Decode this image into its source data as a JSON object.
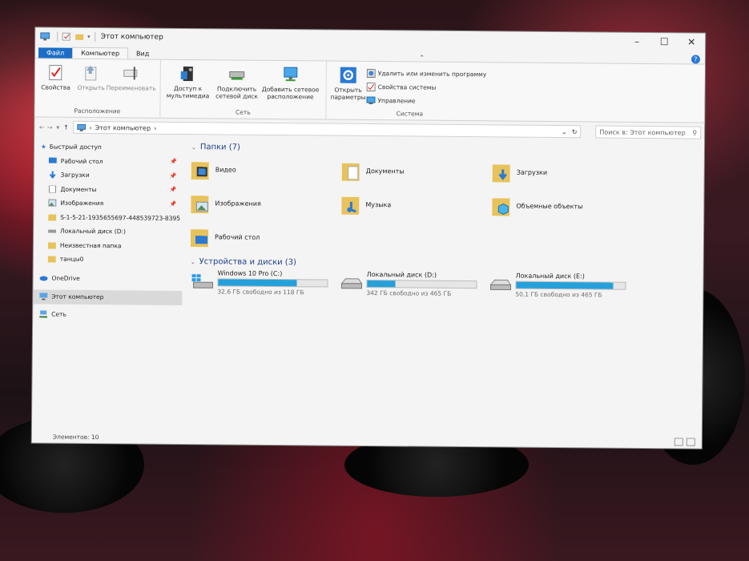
{
  "window": {
    "title": "Этот компьютер",
    "controls": [
      "–",
      "☐",
      "✕"
    ]
  },
  "ribbon_tabs": [
    "Файл",
    "Компьютер",
    "Вид"
  ],
  "ribbon": {
    "location_group": {
      "label": "Расположение",
      "buttons": [
        "Свойства",
        "Открыть",
        "Переименовать"
      ]
    },
    "network_group": {
      "label": "Сеть",
      "buttons": [
        "Доступ к мультимедиа",
        "Подключить сетевой диск",
        "Добавить сетевое расположение"
      ]
    },
    "system_group": {
      "label": "Система",
      "open_settings": "Открыть параметры",
      "items": [
        "Удалить или изменить программу",
        "Свойства системы",
        "Управление"
      ]
    }
  },
  "address": {
    "path": "Этот компьютер",
    "search_placeholder": "Поиск в: Этот компьютер"
  },
  "nav_pane": {
    "quick_access": "Быстрый доступ",
    "quick_items": [
      {
        "label": "Рабочий стол",
        "pinned": true
      },
      {
        "label": "Загрузки",
        "pinned": true
      },
      {
        "label": "Документы",
        "pinned": true
      },
      {
        "label": "Изображения",
        "pinned": true
      },
      {
        "label": "S-1-5-21-1935655697-448539723-8395",
        "pinned": false
      },
      {
        "label": "Локальный диск (D:)",
        "pinned": false
      },
      {
        "label": "Неизвестная папка",
        "pinned": false
      },
      {
        "label": "танцы0",
        "pinned": false
      }
    ],
    "onedrive": "OneDrive",
    "this_pc": "Этот компьютер",
    "network": "Сеть"
  },
  "folders_section": {
    "title": "Папки (7)",
    "items": [
      "Видео",
      "Документы",
      "Загрузки",
      "Изображения",
      "Музыка",
      "Объемные объекты",
      "Рабочий стол"
    ]
  },
  "drives_section": {
    "title": "Устройства и диски (3)",
    "items": [
      {
        "name": "Windows 10 Pro (C:)",
        "free": "32,6 ГБ свободно из 118 ГБ",
        "used_fraction": 0.72
      },
      {
        "name": "Локальный диск (D:)",
        "free": "342 ГБ свободно из 465 ГБ",
        "used_fraction": 0.26
      },
      {
        "name": "Локальный диск (E:)",
        "free": "50,1 ГБ свободно из 465 ГБ",
        "used_fraction": 0.89
      }
    ]
  },
  "status": {
    "item_count": "Элементов: 10"
  },
  "colors": {
    "accent": "#1c6ec5",
    "drive_bar": "#26a0da",
    "section_title": "#1e3f8a"
  }
}
